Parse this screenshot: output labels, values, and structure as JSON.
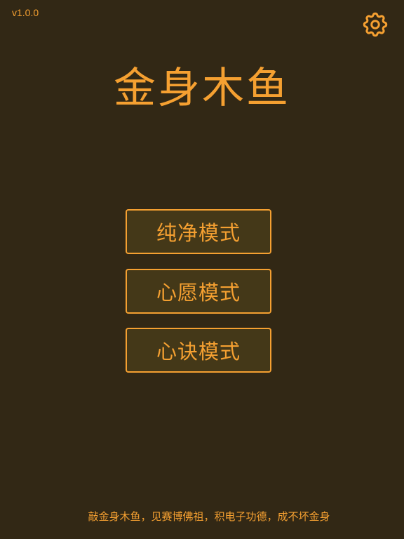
{
  "version": "v1.0.0",
  "title": "金身木鱼",
  "settings": {
    "icon": "gear-icon"
  },
  "modes": [
    {
      "label": "纯净模式"
    },
    {
      "label": "心愿模式"
    },
    {
      "label": "心诀模式"
    }
  ],
  "footer": "敲金身木鱼，见赛博佛祖，积电子功德，成不坏金身",
  "colors": {
    "background": "#322815",
    "accent": "#f5a031",
    "button_fill": "#443818"
  }
}
